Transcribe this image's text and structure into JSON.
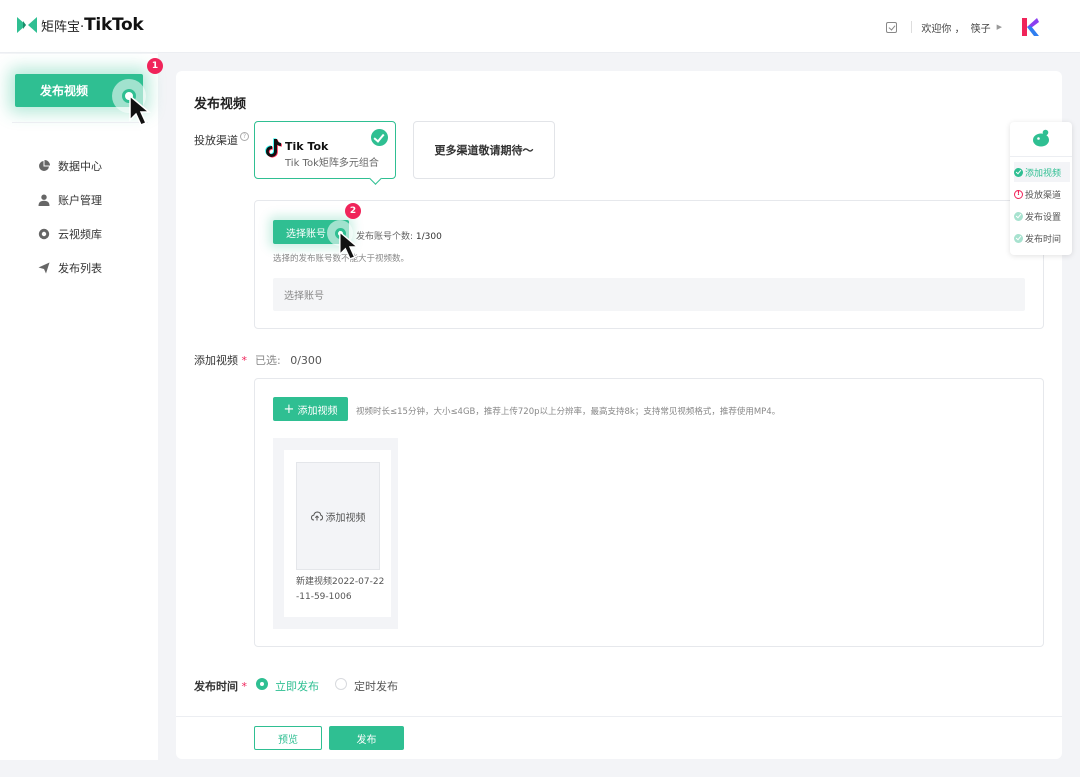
{
  "header": {
    "logo_text": "矩阵宝·",
    "logo_tiktok": "TikTok",
    "welcome": "欢迎你 ，",
    "username": "筷子"
  },
  "sidebar": {
    "publish_label": "发布视频",
    "items": [
      {
        "label": "数据中心",
        "icon": "pie-chart-icon"
      },
      {
        "label": "账户管理",
        "icon": "user-icon"
      },
      {
        "label": "云视频库",
        "icon": "cloud-video-icon"
      },
      {
        "label": "发布列表",
        "icon": "send-icon"
      }
    ]
  },
  "badges": {
    "step1": "1",
    "step2": "2"
  },
  "main": {
    "title": "发布视频",
    "channel_label": "投放渠道",
    "channels": {
      "tiktok_name": "Tik Tok",
      "tiktok_sub": "Tik Tok矩阵多元组合",
      "more": "更多渠道敬请期待～"
    },
    "account": {
      "button": "选择账号",
      "count_prefix": "发布账号个数: ",
      "count": "1/300",
      "hint": "选择的发布账号数不能大于视频数。",
      "placeholder": "选择账号"
    },
    "video": {
      "label": "添加视频",
      "selected_prefix": "已选:",
      "selected": "0/300",
      "button": "添加视频",
      "hint": "视频时长≤15分钟，大小≤4GB，推荐上传720p以上分辨率，最高支持8k；支持常见视频格式，推荐使用MP4。",
      "thumb_label": "添加视频",
      "name": "新建视频2022-07-22-11-59-1006"
    },
    "publish_time": {
      "label": "发布时间",
      "options": [
        "立即发布",
        "定时发布"
      ],
      "selected": "立即发布"
    },
    "footer": {
      "preview": "预览",
      "publish": "发布"
    }
  },
  "steps": [
    {
      "label": "添加视频",
      "status": "done-active"
    },
    {
      "label": "投放渠道",
      "status": "warning"
    },
    {
      "label": "发布设置",
      "status": "done"
    },
    {
      "label": "发布时间",
      "status": "done"
    }
  ],
  "colors": {
    "accent": "#2fbf92",
    "badge": "#f0245a",
    "background": "#f3f4f7"
  }
}
